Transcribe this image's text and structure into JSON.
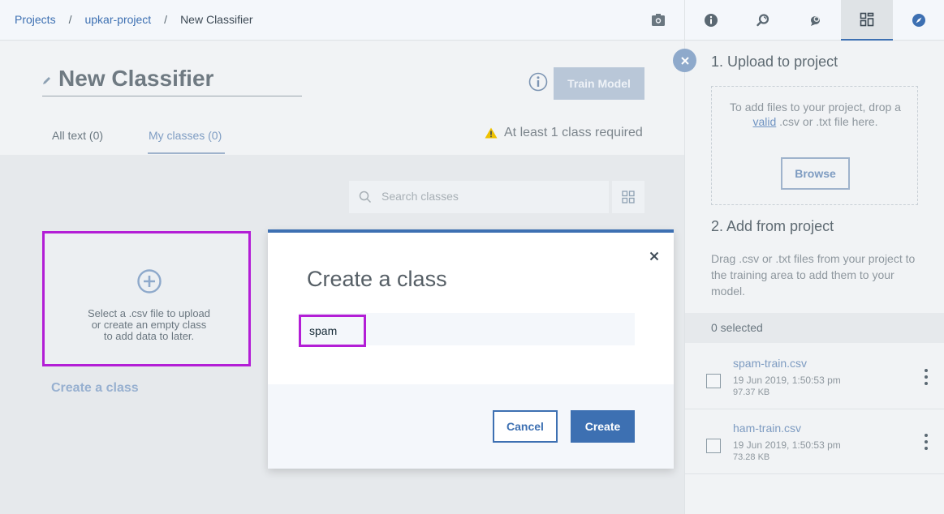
{
  "breadcrumb": {
    "items": [
      "Projects",
      "upkar-project"
    ],
    "separator": "/",
    "current": "New Classifier"
  },
  "header": {
    "title": "New Classifier",
    "train_button": "Train Model"
  },
  "tabs": [
    {
      "label": "All text (0)",
      "active": false
    },
    {
      "label": "My classes (0)",
      "active": true
    }
  ],
  "warning": {
    "text": "At least 1 class required"
  },
  "search": {
    "placeholder": "Search classes"
  },
  "card": {
    "lines": [
      "Select a .csv file to upload",
      "or create an empty class",
      "to add data to later."
    ],
    "link": "Create a class"
  },
  "modal": {
    "title": "Create a class",
    "input_value": "spam",
    "cancel": "Cancel",
    "create": "Create"
  },
  "panel": {
    "upload_heading": "1. Upload to project",
    "upload_text_1": "To add files to your project, drop a",
    "upload_valid": "valid",
    "upload_text_2": ".csv or .txt file here.",
    "browse": "Browse",
    "add_heading": "2. Add from project",
    "add_text": "Drag .csv or .txt files from your project to the training area to add them to your model.",
    "selected": "0 selected",
    "files": [
      {
        "name": "spam-train.csv",
        "date": "19 Jun 2019, 1:50:53 pm",
        "size": "97.37 KB"
      },
      {
        "name": "ham-train.csv",
        "date": "19 Jun 2019, 1:50:53 pm",
        "size": "73.28 KB"
      }
    ]
  },
  "colors": {
    "accent": "#3d70b2",
    "highlight": "#b31ed6",
    "warning": "#efc100"
  },
  "icons": [
    "camera-icon",
    "info-icon",
    "search-tool-icon",
    "comment-icon",
    "grid-icon",
    "compass-icon",
    "pencil-icon",
    "warning-icon",
    "search-icon",
    "plus-circle-icon",
    "close-icon",
    "kebab-icon"
  ]
}
